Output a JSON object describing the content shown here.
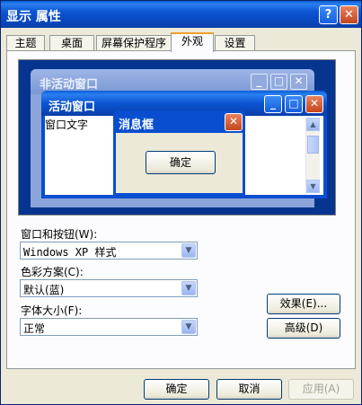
{
  "window": {
    "title": "显示 属性",
    "help_glyph": "?",
    "close_glyph": "✕"
  },
  "tabs": [
    {
      "label": "主题"
    },
    {
      "label": "桌面"
    },
    {
      "label": "屏幕保护程序"
    },
    {
      "label": "外观",
      "active": true
    },
    {
      "label": "设置"
    }
  ],
  "preview": {
    "inactive_title": "非活动窗口",
    "active_title": "活动窗口",
    "window_text": "窗口文字",
    "message_title": "消息框",
    "ok_label": "确定",
    "min_glyph": "_",
    "max_glyph": "□",
    "close_glyph": "✕"
  },
  "fields": {
    "windows_buttons_label": "窗口和按钮(W):",
    "windows_buttons_value": "Windows XP 样式",
    "color_scheme_label": "色彩方案(C):",
    "color_scheme_value": "默认(蓝)",
    "font_size_label": "字体大小(F):",
    "font_size_value": "正常"
  },
  "side_buttons": {
    "effects": "效果(E)...",
    "advanced": "高级(D)"
  },
  "footer": {
    "ok": "确定",
    "cancel": "取消",
    "apply": "应用(A)"
  },
  "colors": {
    "titlebar": "#0b55d2",
    "dialog_bg": "#ece9d8",
    "preview_bg": "#06358f"
  }
}
